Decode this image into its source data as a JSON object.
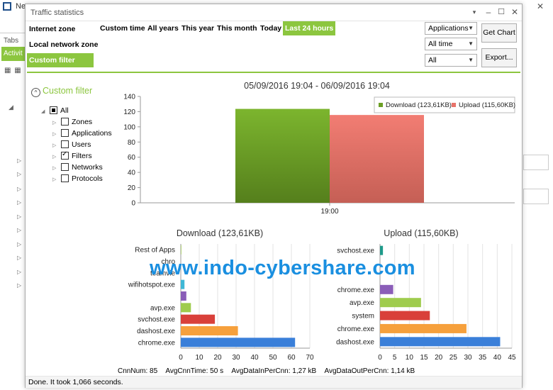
{
  "background_app": {
    "title": "Ne",
    "tabs_label": "Tabs",
    "activity_label": "Activit"
  },
  "dialog": {
    "title": "Traffic statistics",
    "controls": {
      "menu": "▾",
      "minimize": "–",
      "maximize": "☐",
      "close": "✕"
    }
  },
  "zones": [
    {
      "label": "Internet zone",
      "active": false
    },
    {
      "label": "Local network zone",
      "active": false
    },
    {
      "label": "Custom filter",
      "active": true
    }
  ],
  "time_ranges": [
    {
      "label": "Custom time",
      "active": false
    },
    {
      "label": "All years",
      "active": false
    },
    {
      "label": "This year",
      "active": false
    },
    {
      "label": "This month",
      "active": false
    },
    {
      "label": "Today",
      "active": false
    },
    {
      "label": "Last 24 hours",
      "active": true
    }
  ],
  "combos": {
    "group": "Applications",
    "period": "All time",
    "direction": "All"
  },
  "buttons": {
    "get_chart": "Get Chart",
    "export": "Export..."
  },
  "filter_tree": {
    "header": "Custom filter",
    "root": "All",
    "items": [
      {
        "label": "Zones",
        "checked": false
      },
      {
        "label": "Applications",
        "checked": false
      },
      {
        "label": "Users",
        "checked": false
      },
      {
        "label": "Filters",
        "checked": true
      },
      {
        "label": "Networks",
        "checked": false
      },
      {
        "label": "Protocols",
        "checked": false
      }
    ]
  },
  "colors": {
    "accent": "#8cc63f",
    "download": "#6b9f24",
    "upload": "#e8736a"
  },
  "chart_data": [
    {
      "type": "bar",
      "title": "05/09/2016 19:04 - 06/09/2016 19:04",
      "categories": [
        "19:00"
      ],
      "series": [
        {
          "name": "Download (123,61KB)",
          "values": [
            123.61
          ],
          "color": "#6b9f24"
        },
        {
          "name": "Upload (115,60KB)",
          "values": [
            115.6
          ],
          "color": "#e8736a"
        }
      ],
      "ylim": [
        0,
        140
      ],
      "yticks": [
        0,
        20,
        40,
        60,
        80,
        100,
        120,
        140
      ],
      "legend": "top-right",
      "grid": false
    },
    {
      "type": "bar",
      "orientation": "horizontal",
      "title": "Download (123,61KB)",
      "categories": [
        "Rest of Apps",
        "chro",
        "teamvie",
        "wifihotspot.exe",
        "",
        "avp.exe",
        "svchost.exe",
        "dashost.exe",
        "chrome.exe"
      ],
      "values": [
        0.3,
        0,
        0,
        2,
        3,
        5.5,
        18.5,
        31,
        62
      ],
      "colors": [
        "#9fc55a",
        "#9fc55a",
        "#9fc55a",
        "#3fb8d6",
        "#8a5db8",
        "#9fcc4e",
        "#d9403a",
        "#f6a03c",
        "#3a7fd9"
      ],
      "xlim": [
        0,
        70
      ],
      "xticks": [
        0,
        10,
        20,
        30,
        40,
        50,
        60,
        70
      ],
      "grid": true
    },
    {
      "type": "bar",
      "orientation": "horizontal",
      "title": "Upload (115,60KB)",
      "categories": [
        "svchost.exe",
        "",
        "",
        "chrome.exe",
        "avp.exe",
        "system",
        "chrome.exe",
        "dashost.exe"
      ],
      "values": [
        1,
        0,
        0,
        4.5,
        14,
        17,
        29.5,
        41
      ],
      "colors": [
        "#1e9a8a",
        "#ffffff",
        "#ffffff",
        "#8a5db8",
        "#9fcc4e",
        "#d9403a",
        "#f6a03c",
        "#3a7fd9"
      ],
      "xlim": [
        0,
        45
      ],
      "xticks": [
        0,
        5,
        10,
        15,
        20,
        25,
        30,
        35,
        40,
        45
      ],
      "grid": true
    }
  ],
  "stats": {
    "cnn_num": "CnnNum: 85",
    "avg_cnn_time": "AvgCnnTime: 50 s",
    "avg_in": "AvgDataInPerCnn: 1,27 kB",
    "avg_out": "AvgDataOutPerCnn: 1,14 kB"
  },
  "watermark": "www.indo-cybershare.com",
  "status": "Done. It took 1,066 seconds."
}
